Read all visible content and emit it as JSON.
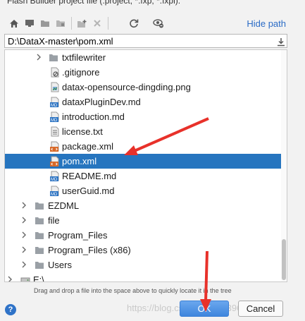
{
  "header": {
    "title": "Flash Builder project file (.project, *.fxp, *.fxpl):"
  },
  "toolbar": {
    "icons": [
      "home-icon",
      "desktop-icon",
      "folder-icon",
      "folder-module-icon",
      "new-folder-icon",
      "delete-icon",
      "refresh-icon",
      "show-hidden-icon"
    ],
    "hide_path_label": "Hide path"
  },
  "path": {
    "value": "D:\\DataX-master\\pom.xml"
  },
  "tree": {
    "items": [
      {
        "label": "txtfilewriter",
        "type": "folder",
        "expandable": true
      },
      {
        "label": ".gitignore",
        "type": "ignore"
      },
      {
        "label": "datax-opensource-dingding.png",
        "type": "image"
      },
      {
        "label": "dataxPluginDev.md",
        "type": "md"
      },
      {
        "label": "introduction.md",
        "type": "md"
      },
      {
        "label": "license.txt",
        "type": "txt"
      },
      {
        "label": "package.xml",
        "type": "xml"
      },
      {
        "label": "pom.xml",
        "type": "xml",
        "selected": true
      },
      {
        "label": "README.md",
        "type": "md"
      },
      {
        "label": "userGuid.md",
        "type": "md"
      },
      {
        "label": "EZDML",
        "type": "folder",
        "expandable": true
      },
      {
        "label": "file",
        "type": "folder",
        "expandable": true
      },
      {
        "label": "Program_Files",
        "type": "folder",
        "expandable": true
      },
      {
        "label": "Program_Files (x86)",
        "type": "folder",
        "expandable": true
      },
      {
        "label": "Users",
        "type": "folder",
        "expandable": true
      },
      {
        "label": "E:\\",
        "type": "drive",
        "expandable": true
      }
    ]
  },
  "hint": "Drag and drop a file into the space above to quickly locate it in the tree",
  "buttons": {
    "help": "?",
    "ok": "OK",
    "cancel": "Cancel"
  },
  "watermark": "https://blog.csdn.net/qq_39623054",
  "colors": {
    "selection": "#2675bf",
    "link": "#2a6bc6",
    "arrow": "#e8312a"
  }
}
